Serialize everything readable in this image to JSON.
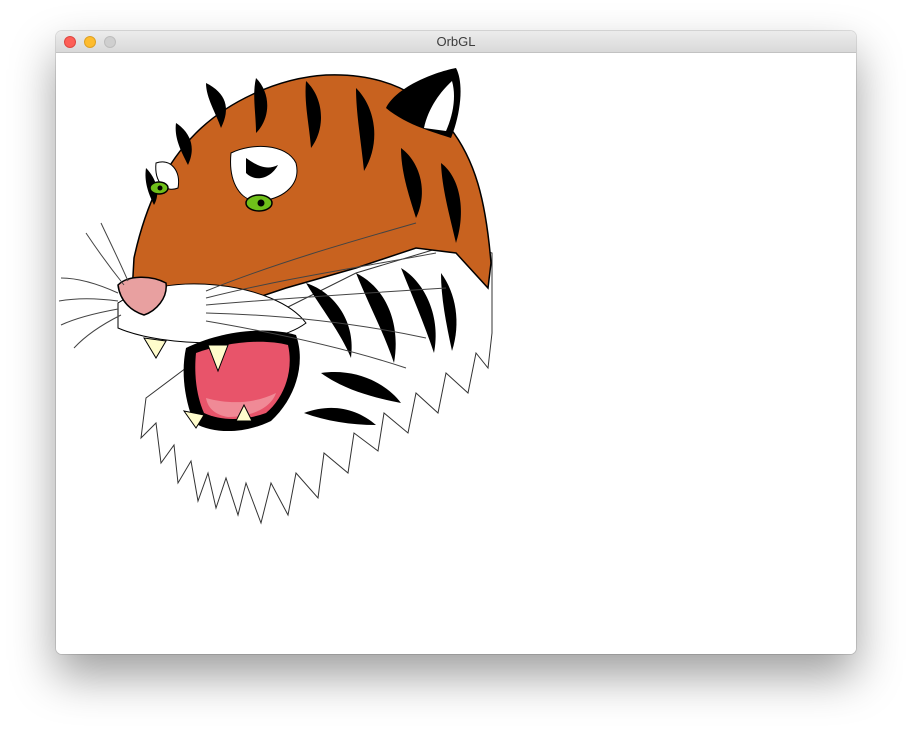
{
  "window": {
    "title": "OrbGL",
    "controls": {
      "close": "close-button",
      "minimize": "minimize-button",
      "zoom": "zoom-button"
    }
  },
  "canvas": {
    "illustration": "tiger-head",
    "colors": {
      "fur_orange": "#c8621f",
      "stripe": "#000000",
      "eye": "#6fbf1a",
      "mouth": "#e8546a",
      "nose": "#e8a0a0",
      "teeth": "#fffccc"
    }
  }
}
